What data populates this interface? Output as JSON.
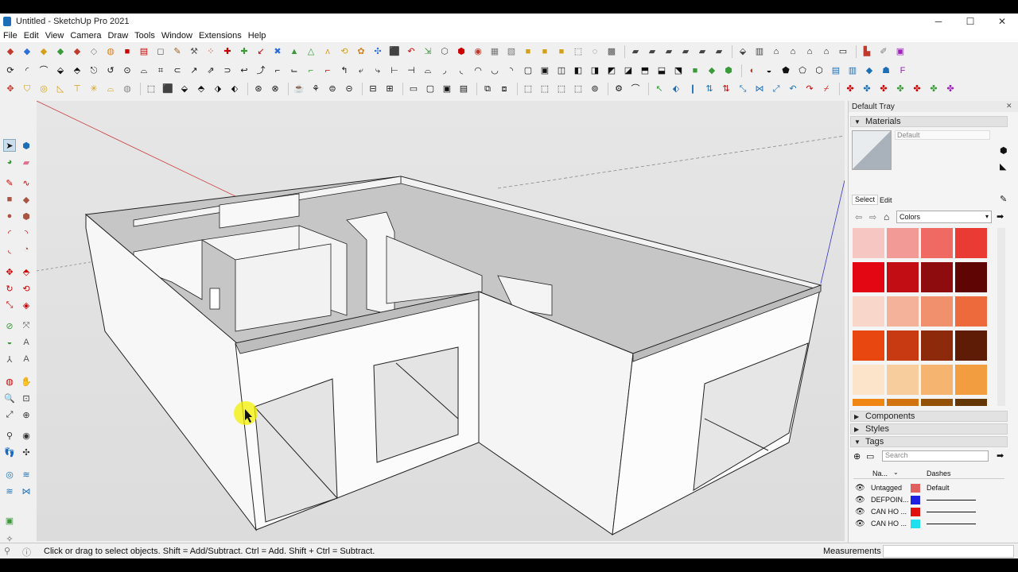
{
  "window": {
    "title": "Untitled - SketchUp Pro 2021",
    "minimize": "─",
    "maximize": "☐",
    "close": "✕"
  },
  "menu": [
    "File",
    "Edit",
    "View",
    "Camera",
    "Draw",
    "Tools",
    "Window",
    "Extensions",
    "Help"
  ],
  "tray": {
    "title": "Default Tray",
    "materials": {
      "header": "Materials",
      "current_name": "Default",
      "tab_select": "Select",
      "tab_edit": "Edit",
      "library": "Colors",
      "swatches": [
        "#f6c7c2",
        "#f29a95",
        "#ee6a62",
        "#e93a33",
        "#e30613",
        "#c20d14",
        "#8e0b0e",
        "#5f0605",
        "#f8d6c9",
        "#f4b29b",
        "#f0906c",
        "#ec6a3c",
        "#e8470f",
        "#c83a12",
        "#8d2a0c",
        "#5e1c07",
        "#fbe4c9",
        "#f8cd9e",
        "#f5b570",
        "#f29d40",
        "#ef8712",
        "#d27510",
        "#935208",
        "#643705"
      ]
    },
    "components_header": "Components",
    "styles_header": "Styles",
    "tags": {
      "header": "Tags",
      "search_placeholder": "Search",
      "col_name": "Na...",
      "col_dashes": "Dashes",
      "rows": [
        {
          "name": "Untagged",
          "color": "#e06060",
          "dash": "Default"
        },
        {
          "name": "DEFPOIN...",
          "color": "#1f1fe0",
          "dash": ""
        },
        {
          "name": "CAN HO ...",
          "color": "#e01010",
          "dash": ""
        },
        {
          "name": "CAN HO ...",
          "color": "#20e0f0",
          "dash": ""
        }
      ]
    }
  },
  "status": {
    "message": "Click or drag to select objects. Shift = Add/Subtract. Ctrl = Add. Shift + Ctrl = Subtract.",
    "measurements_label": "Measurements"
  }
}
